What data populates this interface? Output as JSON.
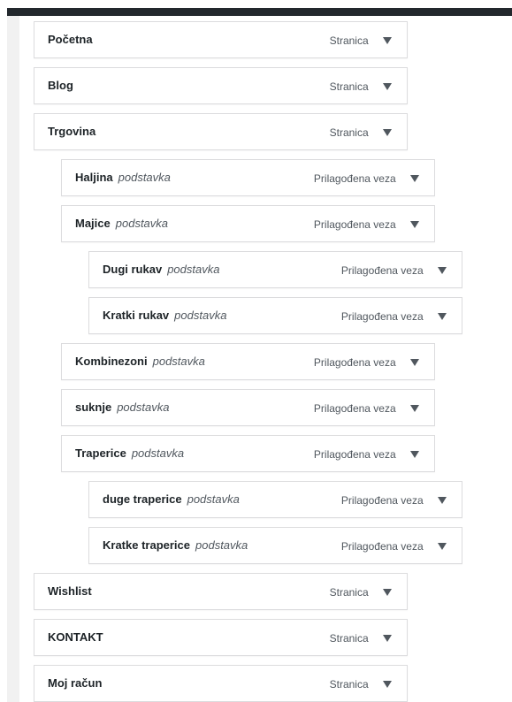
{
  "menu": {
    "items": [
      {
        "label": "Početna",
        "type": "Stranica"
      },
      {
        "label": "Blog",
        "type": "Stranica"
      },
      {
        "label": "Trgovina",
        "type": "Stranica"
      },
      {
        "label": "Haljina",
        "sub": "podstavka",
        "type": "Prilagođena veza"
      },
      {
        "label": "Majice",
        "sub": "podstavka",
        "type": "Prilagođena veza"
      },
      {
        "label": "Dugi rukav",
        "sub": "podstavka",
        "type": "Prilagođena veza"
      },
      {
        "label": "Kratki rukav",
        "sub": "podstavka",
        "type": "Prilagođena veza"
      },
      {
        "label": "Kombinezoni",
        "sub": "podstavka",
        "type": "Prilagođena veza"
      },
      {
        "label": "suknje",
        "sub": "podstavka",
        "type": "Prilagođena veza"
      },
      {
        "label": "Traperice",
        "sub": "podstavka",
        "type": "Prilagođena veza"
      },
      {
        "label": "duge traperice",
        "sub": "podstavka",
        "type": "Prilagođena veza"
      },
      {
        "label": "Kratke traperice",
        "sub": "podstavka",
        "type": "Prilagođena veza"
      },
      {
        "label": "Wishlist",
        "type": "Stranica"
      },
      {
        "label": "KONTAKT",
        "type": "Stranica"
      },
      {
        "label": "Moj račun",
        "type": "Stranica"
      }
    ]
  },
  "colors": {
    "top_bar": "#23282d",
    "border": "#dcdcde",
    "text": "#1d2327",
    "muted": "#50575e"
  },
  "icons": {
    "toggle": "triangle-down-icon"
  }
}
